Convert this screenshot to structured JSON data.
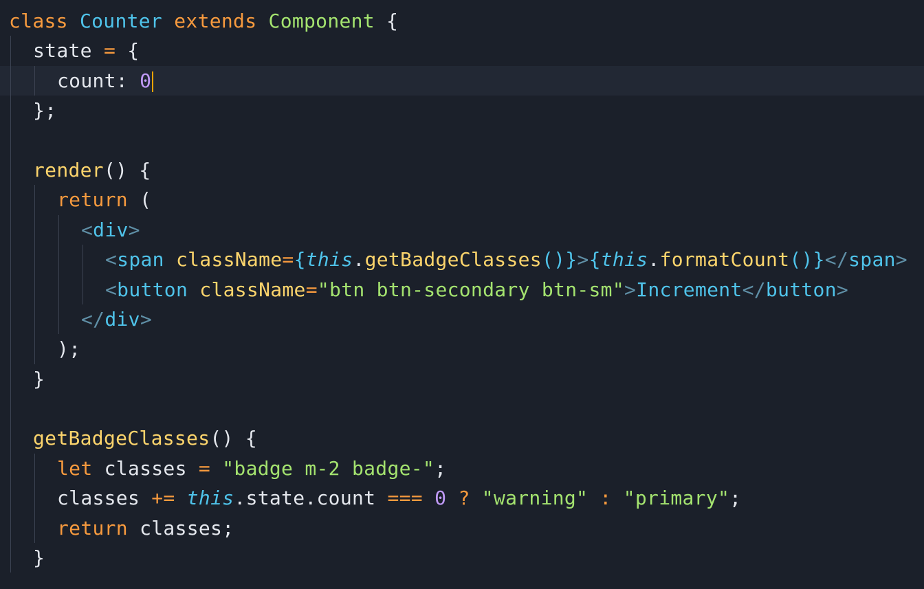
{
  "editor": {
    "theme": {
      "background": "#1b202a",
      "current_line": "#222834",
      "cursor": "#f0a400",
      "indent_guide": "#3c4352"
    },
    "cursor_line": 2,
    "lines": [
      {
        "indent": 0,
        "tokens": [
          {
            "t": "kw",
            "v": "class"
          },
          {
            "t": "plain",
            "v": " "
          },
          {
            "t": "cls",
            "v": "Counter"
          },
          {
            "t": "plain",
            "v": " "
          },
          {
            "t": "kw",
            "v": "extends"
          },
          {
            "t": "plain",
            "v": " "
          },
          {
            "t": "type",
            "v": "Component"
          },
          {
            "t": "plain",
            "v": " "
          },
          {
            "t": "punct",
            "v": "{"
          }
        ]
      },
      {
        "indent": 1,
        "tokens": [
          {
            "t": "plain",
            "v": "state "
          },
          {
            "t": "op",
            "v": "="
          },
          {
            "t": "plain",
            "v": " "
          },
          {
            "t": "punct",
            "v": "{"
          }
        ]
      },
      {
        "indent": 2,
        "tokens": [
          {
            "t": "plain",
            "v": "count: "
          },
          {
            "t": "num",
            "v": "0"
          }
        ]
      },
      {
        "indent": 1,
        "tokens": [
          {
            "t": "punct",
            "v": "};"
          }
        ]
      },
      {
        "indent": 0,
        "tokens": []
      },
      {
        "indent": 1,
        "tokens": [
          {
            "t": "fn",
            "v": "render"
          },
          {
            "t": "punct",
            "v": "() {"
          }
        ]
      },
      {
        "indent": 2,
        "tokens": [
          {
            "t": "kw",
            "v": "return"
          },
          {
            "t": "plain",
            "v": " "
          },
          {
            "t": "punct",
            "v": "("
          }
        ]
      },
      {
        "indent": 3,
        "tokens": [
          {
            "t": "angle",
            "v": "<"
          },
          {
            "t": "tag",
            "v": "div"
          },
          {
            "t": "angle",
            "v": ">"
          }
        ]
      },
      {
        "indent": 4,
        "tokens": [
          {
            "t": "angle",
            "v": "<"
          },
          {
            "t": "tag",
            "v": "span"
          },
          {
            "t": "plain",
            "v": " "
          },
          {
            "t": "attr",
            "v": "className"
          },
          {
            "t": "op",
            "v": "="
          },
          {
            "t": "brace",
            "v": "{"
          },
          {
            "t": "this",
            "v": "this"
          },
          {
            "t": "plain",
            "v": "."
          },
          {
            "t": "fn",
            "v": "getBadgeClasses"
          },
          {
            "t": "brace",
            "v": "()}"
          },
          {
            "t": "angle",
            "v": ">"
          },
          {
            "t": "brace",
            "v": "{"
          },
          {
            "t": "this",
            "v": "this"
          },
          {
            "t": "plain",
            "v": "."
          },
          {
            "t": "fn",
            "v": "formatCount"
          },
          {
            "t": "brace",
            "v": "()}"
          },
          {
            "t": "angle",
            "v": "</"
          },
          {
            "t": "tag",
            "v": "span"
          },
          {
            "t": "angle",
            "v": ">"
          }
        ]
      },
      {
        "indent": 4,
        "tokens": [
          {
            "t": "angle",
            "v": "<"
          },
          {
            "t": "tag",
            "v": "button"
          },
          {
            "t": "plain",
            "v": " "
          },
          {
            "t": "attr",
            "v": "className"
          },
          {
            "t": "op",
            "v": "="
          },
          {
            "t": "str",
            "v": "\"btn btn-secondary btn-sm\""
          },
          {
            "t": "angle",
            "v": ">"
          },
          {
            "t": "tag",
            "v": "Increment"
          },
          {
            "t": "angle",
            "v": "</"
          },
          {
            "t": "tag",
            "v": "button"
          },
          {
            "t": "angle",
            "v": ">"
          }
        ]
      },
      {
        "indent": 3,
        "tokens": [
          {
            "t": "angle",
            "v": "</"
          },
          {
            "t": "tag",
            "v": "div"
          },
          {
            "t": "angle",
            "v": ">"
          }
        ]
      },
      {
        "indent": 2,
        "tokens": [
          {
            "t": "punct",
            "v": ");"
          }
        ]
      },
      {
        "indent": 1,
        "tokens": [
          {
            "t": "punct",
            "v": "}"
          }
        ]
      },
      {
        "indent": 0,
        "tokens": []
      },
      {
        "indent": 1,
        "tokens": [
          {
            "t": "fn",
            "v": "getBadgeClasses"
          },
          {
            "t": "punct",
            "v": "() {"
          }
        ]
      },
      {
        "indent": 2,
        "tokens": [
          {
            "t": "kw",
            "v": "let"
          },
          {
            "t": "plain",
            "v": " classes "
          },
          {
            "t": "op",
            "v": "="
          },
          {
            "t": "plain",
            "v": " "
          },
          {
            "t": "str",
            "v": "\"badge m-2 badge-\""
          },
          {
            "t": "punct",
            "v": ";"
          }
        ]
      },
      {
        "indent": 2,
        "tokens": [
          {
            "t": "plain",
            "v": "classes "
          },
          {
            "t": "op",
            "v": "+="
          },
          {
            "t": "plain",
            "v": " "
          },
          {
            "t": "this",
            "v": "this"
          },
          {
            "t": "plain",
            "v": ".state.count "
          },
          {
            "t": "op",
            "v": "==="
          },
          {
            "t": "plain",
            "v": " "
          },
          {
            "t": "num",
            "v": "0"
          },
          {
            "t": "plain",
            "v": " "
          },
          {
            "t": "op",
            "v": "?"
          },
          {
            "t": "plain",
            "v": " "
          },
          {
            "t": "str",
            "v": "\"warning\""
          },
          {
            "t": "plain",
            "v": " "
          },
          {
            "t": "op",
            "v": ":"
          },
          {
            "t": "plain",
            "v": " "
          },
          {
            "t": "str",
            "v": "\"primary\""
          },
          {
            "t": "punct",
            "v": ";"
          }
        ]
      },
      {
        "indent": 2,
        "tokens": [
          {
            "t": "kw",
            "v": "return"
          },
          {
            "t": "plain",
            "v": " classes;"
          }
        ]
      },
      {
        "indent": 1,
        "tokens": [
          {
            "t": "punct",
            "v": "}"
          }
        ]
      }
    ]
  }
}
